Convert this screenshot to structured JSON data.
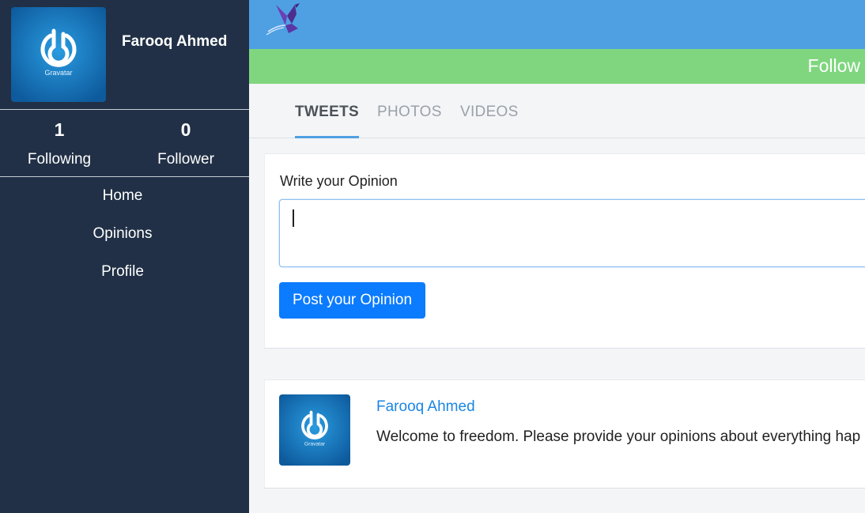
{
  "sidebar": {
    "user_name": "Farooq Ahmed",
    "avatar_caption": "Gravatar",
    "stats": {
      "following_count": "1",
      "following_label": "Following",
      "follower_count": "0",
      "follower_label": "Follower"
    },
    "nav": [
      {
        "label": "Home"
      },
      {
        "label": "Opinions"
      },
      {
        "label": "Profile"
      }
    ]
  },
  "header": {
    "logo_icon": "hummingbird-logo-icon",
    "follow_label": "Follow"
  },
  "tabs": [
    {
      "label": "TWEETS",
      "active": true
    },
    {
      "label": "PHOTOS",
      "active": false
    },
    {
      "label": "VIDEOS",
      "active": false
    }
  ],
  "composer": {
    "label": "Write your Opinion",
    "value": "",
    "button_label": "Post your Opinion"
  },
  "feed": [
    {
      "author": "Farooq Ahmed",
      "avatar_caption": "Gravatar",
      "text": "Welcome to freedom. Please provide your opinions about everything hap"
    }
  ],
  "colors": {
    "sidebar_bg": "#213046",
    "topbar_bg": "#4fa0e2",
    "follow_strip_bg": "#7fd67e",
    "primary_button": "#0b7bff",
    "link": "#1a86e4"
  }
}
